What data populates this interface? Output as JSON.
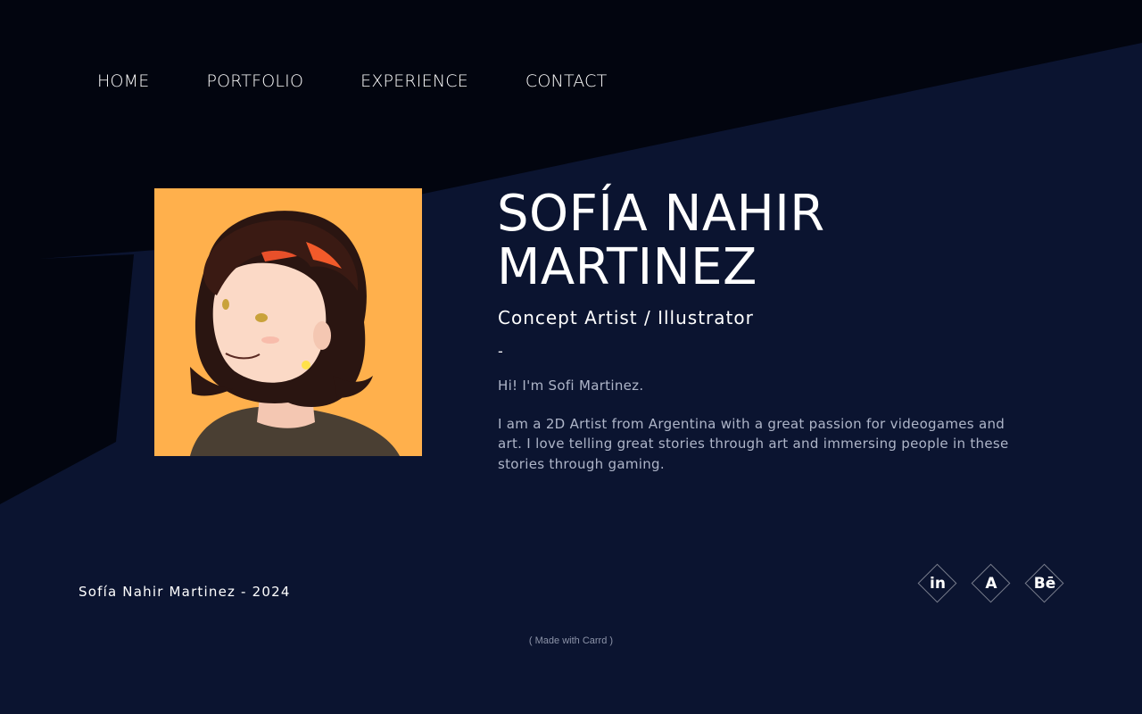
{
  "nav": {
    "items": [
      {
        "label": "HOME"
      },
      {
        "label": "PORTFOLIO"
      },
      {
        "label": "EXPERIENCE"
      },
      {
        "label": "CONTACT"
      }
    ]
  },
  "hero": {
    "name_line1": "SOFÍA NAHIR",
    "name_line2": "MARTINEZ",
    "role": "Concept Artist / Illustrator",
    "divider": "-",
    "bio_greeting": "Hi! I'm Sofi Martinez.",
    "bio_body": "I am a 2D Artist from Argentina with a great passion for videogames and art. I love telling great stories through art and immersing people in these stories through gaming."
  },
  "footer": {
    "copyright": "Sofía Nahir Martinez - 2024",
    "credit": "( Made with Carrd )",
    "socials": [
      {
        "icon": "linkedin-icon",
        "glyph": "in"
      },
      {
        "icon": "artstation-icon",
        "glyph": "A"
      },
      {
        "icon": "behance-icon",
        "glyph": "Bē"
      }
    ]
  },
  "colors": {
    "background": "#0b1430",
    "background_dark": "#02050f",
    "portrait_bg": "#ffb04c",
    "text": "#ffffff",
    "muted_text": "#aeb5c8"
  }
}
